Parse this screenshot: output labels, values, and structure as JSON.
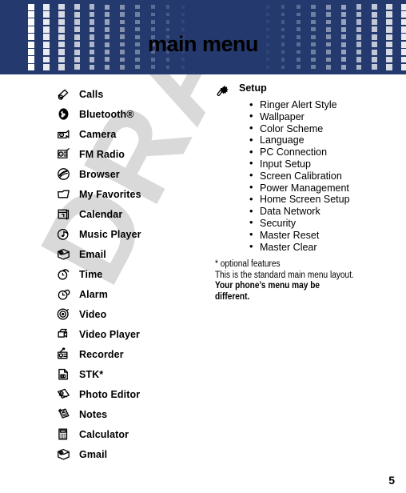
{
  "header": {
    "title": "main menu",
    "bg_color": "#24396e",
    "pattern_color": "#ffffff",
    "left_pattern_icon": "square-dot-grid-fade-right-icon",
    "right_pattern_icon": "square-dot-grid-fade-left-icon"
  },
  "watermark": {
    "text": "DRAFT",
    "color": "#d9d9d9"
  },
  "menu": {
    "items": [
      {
        "label": "Calls",
        "icon": "calls-icon"
      },
      {
        "label": "Bluetooth®",
        "icon": "bluetooth-icon"
      },
      {
        "label": "Camera",
        "icon": "camera-icon"
      },
      {
        "label": "FM Radio",
        "icon": "fm-radio-icon"
      },
      {
        "label": "Browser",
        "icon": "browser-icon"
      },
      {
        "label": "My Favorites",
        "icon": "folder-icon"
      },
      {
        "label": "Calendar",
        "icon": "calendar-icon"
      },
      {
        "label": "Music Player",
        "icon": "music-player-icon"
      },
      {
        "label": "Email",
        "icon": "email-icon"
      },
      {
        "label": "Time",
        "icon": "time-icon"
      },
      {
        "label": "Alarm",
        "icon": "alarm-icon"
      },
      {
        "label": "Video",
        "icon": "video-icon"
      },
      {
        "label": "Video Player",
        "icon": "video-player-icon"
      },
      {
        "label": "Recorder",
        "icon": "recorder-icon"
      },
      {
        "label": "STK*",
        "icon": "stk-icon"
      },
      {
        "label": "Photo Editor",
        "icon": "photo-editor-icon"
      },
      {
        "label": "Notes",
        "icon": "notes-icon"
      },
      {
        "label": "Calculator",
        "icon": "calculator-icon"
      },
      {
        "label": "Gmail",
        "icon": "gmail-icon"
      }
    ]
  },
  "setup": {
    "title": "Setup",
    "icon": "gear-wrench-icon",
    "items": [
      "Ringer Alert Style",
      "Wallpaper",
      "Color Scheme",
      "Language",
      "PC Connection",
      "Input Setup",
      "Screen Calibration",
      "Power Management",
      "Home Screen Setup",
      "Data Network",
      "Security",
      "Master Reset",
      "Master Clear"
    ]
  },
  "footnote": {
    "line1": "* optional features",
    "line2": "This is the standard main menu layout.",
    "line3": "Your phone’s menu may be",
    "line4": "different."
  },
  "page_number": "5"
}
